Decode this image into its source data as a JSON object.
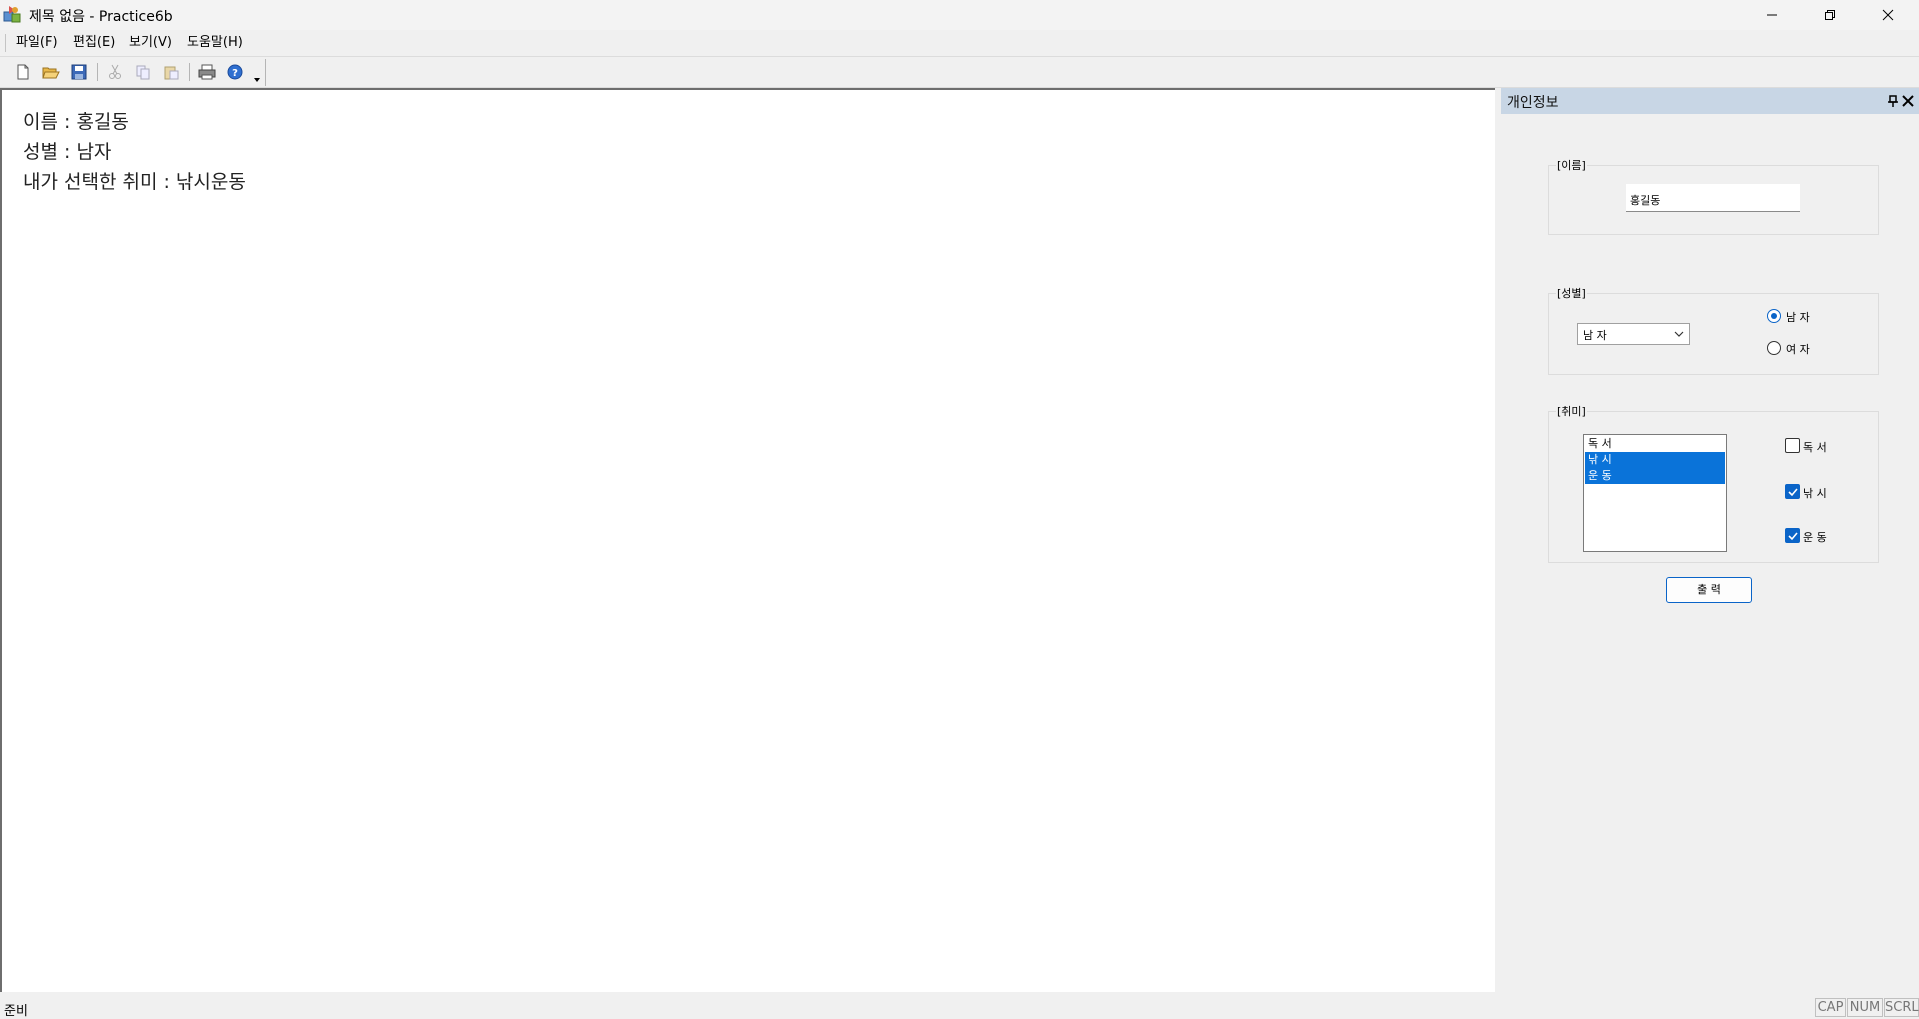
{
  "window": {
    "title": "제목 없음 - Practice6b",
    "app_icon": "practice-app-icon",
    "controls": [
      "minimize-icon",
      "restore-icon",
      "close-icon"
    ]
  },
  "menu": {
    "items": [
      {
        "label": "파일(F)"
      },
      {
        "label": "편집(E)"
      },
      {
        "label": "보기(V)"
      },
      {
        "label": "도움말(H)"
      }
    ]
  },
  "toolbar": {
    "buttons": [
      "new-icon",
      "open-icon",
      "save-icon",
      "cut-icon",
      "copy-icon",
      "paste-icon",
      "print-icon",
      "help-icon",
      "overflow-arrow-icon"
    ]
  },
  "document": {
    "lines": [
      "이름 : 홍길동",
      "성별 : 남자",
      "내가 선택한 취미 : 낚시운동"
    ]
  },
  "pane": {
    "title": "개인정보",
    "name_group": {
      "label": "[이름]",
      "value": "홍길동"
    },
    "gender_group": {
      "label": "[성별]",
      "combo_value": "남 자",
      "options": [
        {
          "label": "남 자",
          "checked": true
        },
        {
          "label": "여 자",
          "checked": false
        }
      ]
    },
    "hobby_group": {
      "label": "[취미]",
      "list": [
        {
          "label": "독 서",
          "selected": false
        },
        {
          "label": "낚 시",
          "selected": true
        },
        {
          "label": "운 동",
          "selected": true
        }
      ],
      "checks": [
        {
          "label": "독 서",
          "checked": false
        },
        {
          "label": "낚 시",
          "checked": true
        },
        {
          "label": "운 동",
          "checked": true
        }
      ]
    },
    "print_button": "출 력"
  },
  "status": {
    "text": "준비",
    "indicators": [
      "CAP",
      "NUM",
      "SCRL"
    ]
  },
  "colors": {
    "accent": "#0a64c8",
    "selection": "#0a73d9",
    "pane_header": "#c8d6e5"
  }
}
